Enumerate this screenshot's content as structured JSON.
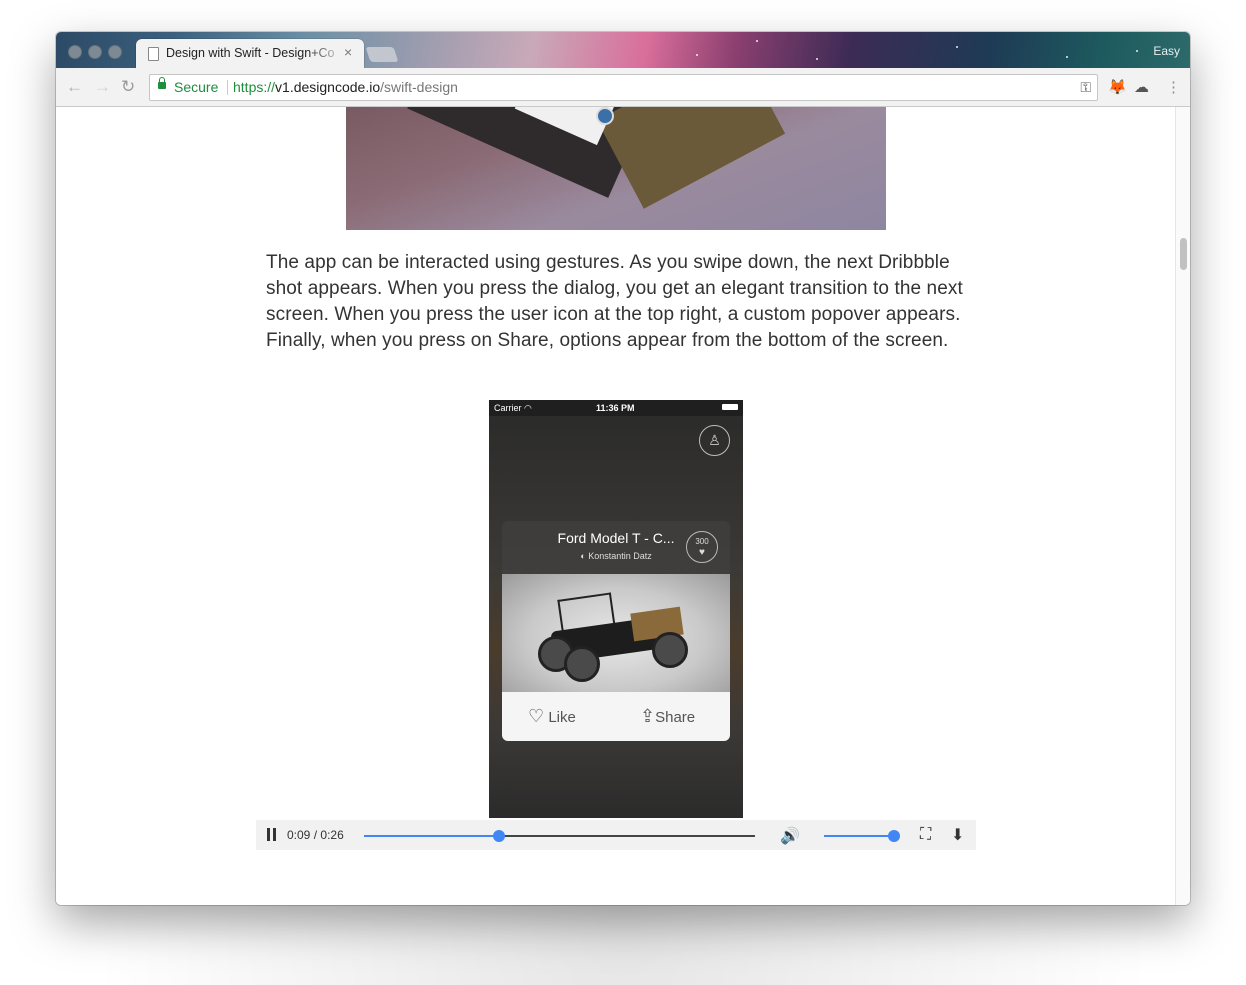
{
  "browser": {
    "tab_title": "Design with Swift - Design+Co",
    "tab_close": "×",
    "profile_name": "Easy",
    "back_icon": "←",
    "forward_icon": "→",
    "reload_icon": "↻",
    "secure_label": "Secure",
    "url_scheme": "https://",
    "url_host": "v1.designcode.io",
    "url_path": "/swift-design",
    "key_icon": "⚿",
    "ext_fox_icon": "🦊",
    "ext_cloud_icon": "☁",
    "menu_icon": "⋮"
  },
  "article": {
    "paragraph": "The app can be interacted using gestures. As you swipe down, the next Dribbble shot appears. When you press the dialog, you get an elegant transition to the next screen. When you press the user icon at the top right, a custom popover appears. Finally, when you press on Share, options appear from the bottom of the screen."
  },
  "phone": {
    "carrier": "Carrier",
    "wifi_icon": "◠",
    "time": "11:36 PM",
    "user_icon": "♙",
    "card_title": "Ford Model T - C...",
    "card_author": "Konstantin Datz",
    "author_avatar_icon": "◐",
    "card_likes": "300",
    "card_heart_icon": "♥",
    "like_icon": "♡",
    "like_label": "Like",
    "share_icon": "⇪",
    "share_label": "Share"
  },
  "video": {
    "current_time": "0:09",
    "time_separator": "/",
    "duration": "0:26",
    "progress_fraction": 0.3462,
    "volume_fraction": 1.0,
    "volume_icon": "🔊",
    "fullscreen_icon": "⛶",
    "download_icon": "⬇",
    "accent_color": "#4285f4"
  }
}
